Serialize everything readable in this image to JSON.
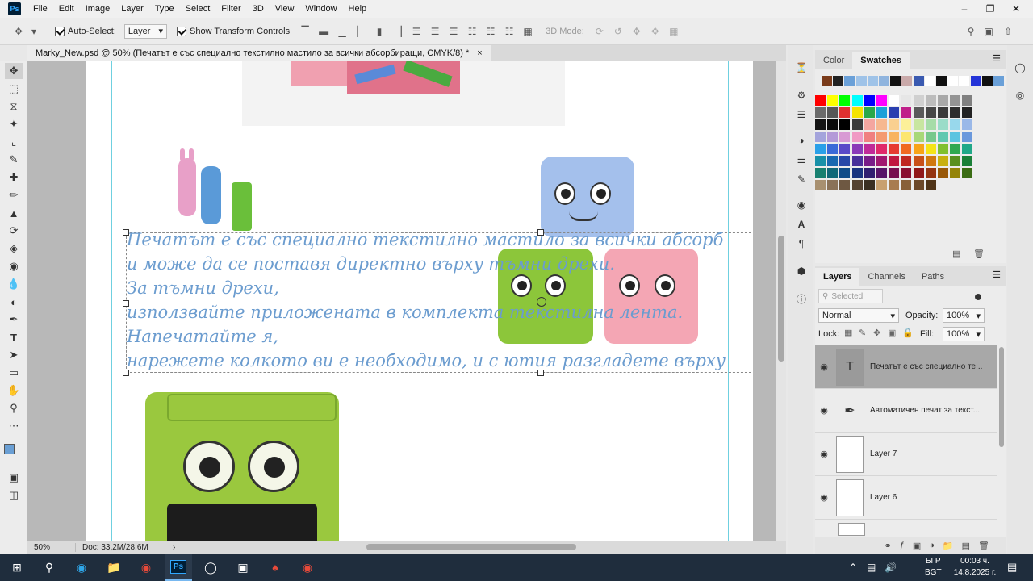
{
  "menubar": {
    "app_badge": "Ps",
    "items": [
      "File",
      "Edit",
      "Image",
      "Layer",
      "Type",
      "Select",
      "Filter",
      "3D",
      "View",
      "Window",
      "Help"
    ]
  },
  "options": {
    "auto_select_label": "Auto-Select:",
    "auto_select_value": "Layer",
    "show_transform_label": "Show Transform Controls",
    "mode_3d_label": "3D Mode:"
  },
  "document": {
    "tab_title": "Marky_New.psd @ 50% (Печатът е със специално текстилно мастило за всички абсорбиращи, CMYK/8) *",
    "close_glyph": "×",
    "text_lines": [
      "Печатът е със специално текстилно мастило за всички абсорб",
      "и може да се поставя директно върху тъмни дрехи.",
      "За тъмни дрехи,",
      "използвайте приложената в комплекта текстилна лента.",
      "Напечатайте я,",
      "нарежете колкото ви е необходимо, и с ютия разгладете върху"
    ]
  },
  "status": {
    "zoom": "50%",
    "doc_info": "Doc: 33,2M/28,6M"
  },
  "color_panel": {
    "tabs": [
      "Color",
      "Swatches"
    ],
    "active": "Swatches"
  },
  "swatches": {
    "row0": [
      "#7a3b1a",
      "#222222",
      "#6aa0d8",
      "#9fc3e8",
      "#9fc3e8",
      "#8fb4de",
      "#111111",
      "#c9a9a9",
      "#3a5ab0",
      "#ffffff",
      "#111111",
      "#ffffff",
      "#ffffff",
      "#2434d8",
      "#111111",
      "#6aa0d8"
    ],
    "grid": [
      [
        "#ff0000",
        "#ffff00",
        "#00ff00",
        "#00ffff",
        "#0000ff",
        "#ff00ff",
        "#ffffff",
        "#e6e6e6",
        "#d0d0d0",
        "#bcbcbc",
        "#a8a8a8",
        "#949494",
        "#808080"
      ],
      [
        "#6b6b6b",
        "#575757",
        "#e03030",
        "#f4e400",
        "#2aa84a",
        "#1aa0d8",
        "#2a3fb0",
        "#c0208a",
        "#5a5a5a",
        "#464646",
        "#3a3a3a",
        "#2e2e2e",
        "#222222"
      ],
      [
        "#141414",
        "#0a0a0a",
        "#000000",
        "#3a3a3a",
        "#f4a6a0",
        "#f6b890",
        "#fad090",
        "#fcf098",
        "#c8e6a0",
        "#a6dca8",
        "#9adcc8",
        "#98d8ec",
        "#9ab8e8"
      ],
      [
        "#a4a4dc",
        "#b49ad8",
        "#d89ad4",
        "#f09ac4",
        "#f08080",
        "#f49a70",
        "#f8b460",
        "#fce670",
        "#a8d878",
        "#78c88c",
        "#60c8b0",
        "#5cc4e0",
        "#6a98dc"
      ],
      [
        "#2aa0e8",
        "#3a6ad8",
        "#5a4ac8",
        "#8a3ab8",
        "#c02a98",
        "#e02a6a",
        "#e63a30",
        "#f06a20",
        "#f8a418",
        "#f4e418",
        "#80c030",
        "#30a850",
        "#20a888"
      ],
      [
        "#1890a8",
        "#1868b0",
        "#2848a8",
        "#48309a",
        "#781c88",
        "#a01870",
        "#c01840",
        "#c02820",
        "#c85018",
        "#d07810",
        "#c8b010",
        "#5a9020",
        "#1a8038"
      ],
      [
        "#188070",
        "#106878",
        "#104c88",
        "#1a3480",
        "#301e70",
        "#581468",
        "#781050",
        "#8a1030",
        "#901818",
        "#943410",
        "#985808",
        "#948408",
        "#3a6c14"
      ],
      [
        "#a89070",
        "#8a7258",
        "#6e5842",
        "#544232",
        "#3a2e22",
        "#c8a070",
        "#a87c50",
        "#886038",
        "#6c4828",
        "#503418"
      ]
    ]
  },
  "layers_panel": {
    "tabs": [
      "Layers",
      "Channels",
      "Paths"
    ],
    "search_placeholder": "Selected",
    "blend_mode": "Normal",
    "opacity_label": "Opacity:",
    "opacity_value": "100%",
    "lock_label": "Lock:",
    "fill_label": "Fill:",
    "fill_value": "100%",
    "layers": [
      {
        "name": "Печатът е със специално те...",
        "thumb": "T",
        "selected": true
      },
      {
        "name": "Автоматичен печат за текст...",
        "thumb": "path",
        "selected": false
      },
      {
        "name": "Layer 7",
        "thumb": "",
        "selected": false
      },
      {
        "name": "Layer 6",
        "thumb": "",
        "selected": false
      }
    ]
  },
  "taskbar": {
    "lang": "БГР",
    "lang2": "BGT",
    "time": "00:03 ч.",
    "date": "14.8.2025 г."
  },
  "colors": {
    "text_blue": "#6b9ccf",
    "selected_layer": "#a8a8a8",
    "taskbar": "#1f2d3d"
  }
}
